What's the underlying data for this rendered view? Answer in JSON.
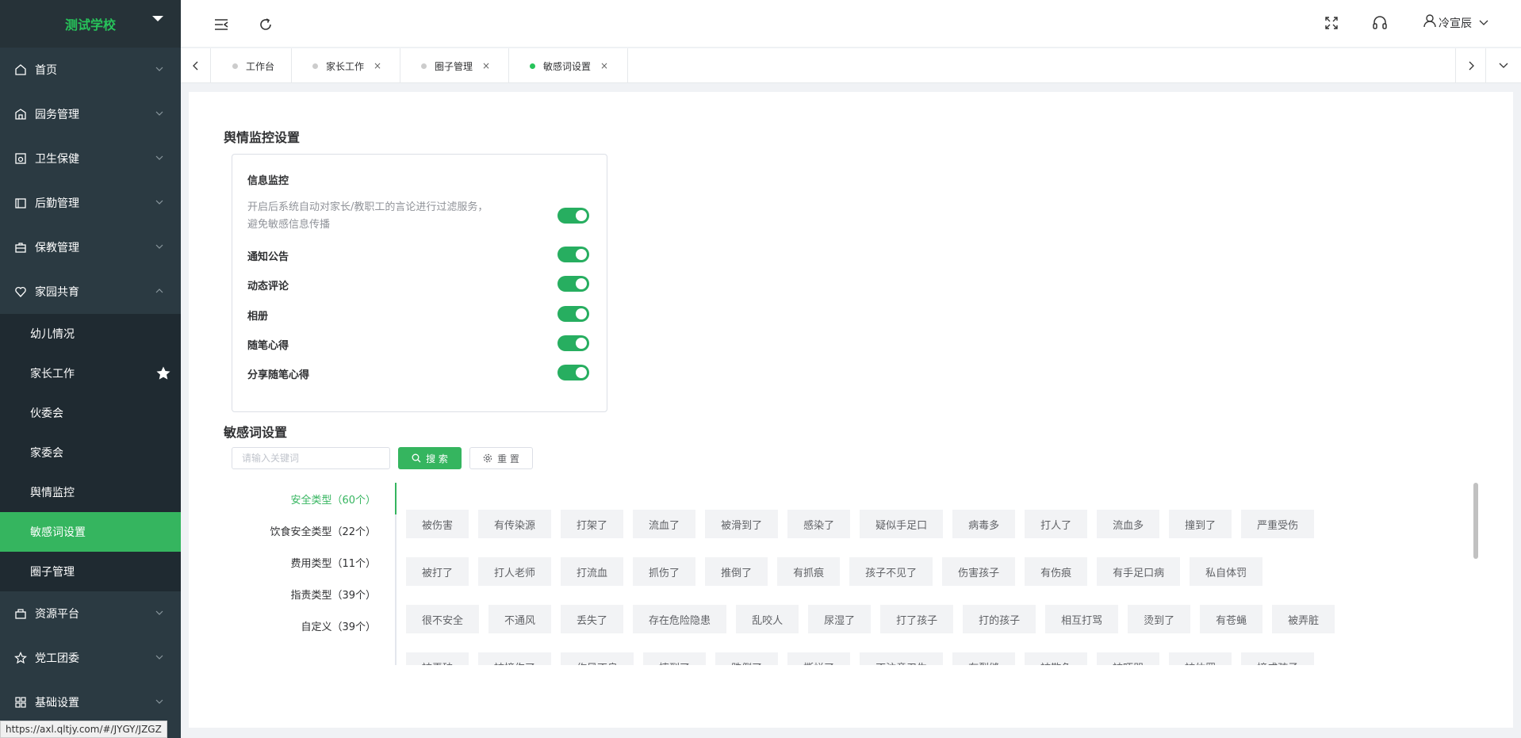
{
  "sidebar": {
    "school_name": "测试学校",
    "menu": [
      {
        "label": "首页",
        "icon": "home-icon"
      },
      {
        "label": "园务管理",
        "icon": "building-icon"
      },
      {
        "label": "卫生保健",
        "icon": "medical-icon"
      },
      {
        "label": "后勤管理",
        "icon": "logistics-icon"
      },
      {
        "label": "保教管理",
        "icon": "briefcase-icon"
      },
      {
        "label": "家园共育",
        "icon": "heart-icon"
      },
      {
        "label": "资源平台",
        "icon": "resource-icon"
      },
      {
        "label": "党工团委",
        "icon": "star-outline-icon"
      },
      {
        "label": "基础设置",
        "icon": "grid-icon"
      }
    ],
    "submenu": [
      "幼儿情况",
      "家长工作",
      "伙委会",
      "家委会",
      "舆情监控",
      "敏感词设置",
      "圈子管理"
    ]
  },
  "status_url": "https://axl.qltjy.com/#/JYGY/JZGZ",
  "header": {
    "user_name": "冷宣辰"
  },
  "tabs": [
    {
      "label": "工作台",
      "closable": false
    },
    {
      "label": "家长工作",
      "closable": true
    },
    {
      "label": "圈子管理",
      "closable": true
    },
    {
      "label": "敏感词设置",
      "closable": true
    }
  ],
  "tab_close": "×",
  "monitor": {
    "section_title": "舆情监控设置",
    "box_title": "信息监控",
    "description": "开启后系统自动对家长/教职工的言论进行过滤服务， 避免敏感信息传播",
    "rows": [
      "通知公告",
      "动态评论",
      "相册",
      "随笔心得",
      "分享随笔心得"
    ]
  },
  "sensitive": {
    "section_title": "敏感词设置",
    "search_placeholder": "请输入关键词",
    "search_label": "搜 索",
    "reset_label": "重 置",
    "categories": [
      "安全类型（60个）",
      "饮食安全类型（22个）",
      "费用类型（11个）",
      "指责类型（39个）",
      "自定义（39个）"
    ],
    "word_rows": [
      [
        "被伤害",
        "有传染源",
        "打架了",
        "流血了",
        "被滑到了",
        "感染了",
        "疑似手足口",
        "病毒多",
        "打人了",
        "流血多",
        "撞到了",
        "严重受伤"
      ],
      [
        "被打了",
        "打人老师",
        "打流血",
        "抓伤了",
        "推倒了",
        "有抓痕",
        "孩子不见了",
        "伤害孩子",
        "有伤痕",
        "有手足口病",
        "私自体罚"
      ],
      [
        "很不安全",
        "不通风",
        "丢失了",
        "存在危险隐患",
        "乱咬人",
        "尿湿了",
        "打了孩子",
        "打的孩子",
        "相互打骂",
        "烫到了",
        "有苍蝇",
        "被弄脏"
      ],
      [
        "被弄破",
        "被撞伤了",
        "作风不良",
        "摔到了",
        "跌倒了",
        "撕烂了",
        "不注意卫生",
        "有裂缝",
        "被欺负",
        "被吓哭",
        "被体罚",
        "撞成孩子"
      ]
    ]
  }
}
